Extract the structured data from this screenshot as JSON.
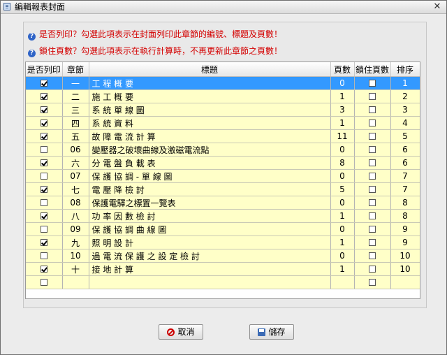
{
  "window": {
    "title": "編輯報表封面",
    "close_glyph": "✕"
  },
  "info": {
    "line1": "是否列印？勾選此項表示在封面列印此章節的編號、標題及頁數！",
    "line2": "鎖住頁數？勾選此項表示在執行計算時，不再更新此章節之頁數！"
  },
  "table": {
    "headers": {
      "print": "是否列印",
      "chapter": "章節",
      "title": "標題",
      "pages": "頁數",
      "lock": "鎖住頁數",
      "order": "排序"
    },
    "rows": [
      {
        "print": true,
        "chapter": "一",
        "title": "工 程 概 要",
        "pages": "0",
        "lock": false,
        "order": "1",
        "selected": true
      },
      {
        "print": true,
        "chapter": "二",
        "title": "施 工 概 要",
        "pages": "1",
        "lock": false,
        "order": "2"
      },
      {
        "print": true,
        "chapter": "三",
        "title": "系 統 單 線 圖",
        "pages": "3",
        "lock": false,
        "order": "3"
      },
      {
        "print": true,
        "chapter": "四",
        "title": "系 統 資 料",
        "pages": "1",
        "lock": false,
        "order": "4"
      },
      {
        "print": true,
        "chapter": "五",
        "title": "故 障 電 流 計 算",
        "pages": "11",
        "lock": false,
        "order": "5"
      },
      {
        "print": false,
        "chapter": "06",
        "title": "變壓器之破壞曲線及激磁電流點",
        "pages": "0",
        "lock": false,
        "order": "6"
      },
      {
        "print": true,
        "chapter": "六",
        "title": "分 電 盤 負 載 表",
        "pages": "8",
        "lock": false,
        "order": "6"
      },
      {
        "print": false,
        "chapter": "07",
        "title": "保 護 協 調 - 單 線 圖",
        "pages": "0",
        "lock": false,
        "order": "7"
      },
      {
        "print": true,
        "chapter": "七",
        "title": "電 壓 降 檢 討",
        "pages": "5",
        "lock": false,
        "order": "7"
      },
      {
        "print": false,
        "chapter": "08",
        "title": "保護電驛之標置一覽表",
        "pages": "0",
        "lock": false,
        "order": "8"
      },
      {
        "print": true,
        "chapter": "八",
        "title": "功 率 因 數 檢 討",
        "pages": "1",
        "lock": false,
        "order": "8"
      },
      {
        "print": false,
        "chapter": "09",
        "title": "保 護 協 調 曲 線 圖",
        "pages": "0",
        "lock": false,
        "order": "9"
      },
      {
        "print": true,
        "chapter": "九",
        "title": "照 明 設 計",
        "pages": "1",
        "lock": false,
        "order": "9"
      },
      {
        "print": false,
        "chapter": "10",
        "title": "過 電 流 保 護 之 設 定 檢 討",
        "pages": "0",
        "lock": false,
        "order": "10"
      },
      {
        "print": true,
        "chapter": "十",
        "title": "接 地 計 算",
        "pages": "1",
        "lock": false,
        "order": "10"
      },
      {
        "print": false,
        "chapter": "",
        "title": "",
        "pages": "",
        "lock": false,
        "order": ""
      }
    ]
  },
  "buttons": {
    "cancel": "取消",
    "save": "儲存"
  }
}
